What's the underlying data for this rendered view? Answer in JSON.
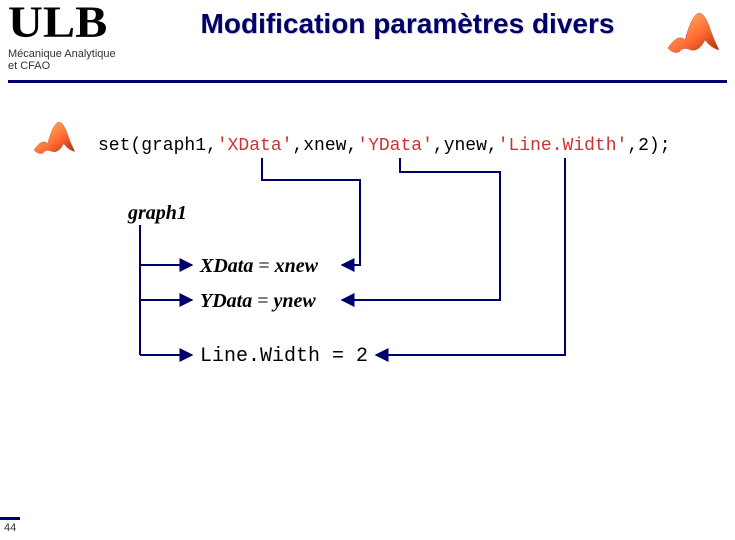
{
  "logo": {
    "text": "ULB",
    "subtitle_line1": "Mécanique Analytique",
    "subtitle_line2": "et CFAO"
  },
  "title": "Modification paramètres divers",
  "code": {
    "prefix": "set(graph1,",
    "s1": "'XData'",
    "m1": ",xnew,",
    "s2": "'YData'",
    "m2": ",ynew,",
    "s3": "'Line.Width'",
    "suffix": ",2);"
  },
  "graph_label": "graph1",
  "rows": [
    {
      "label": "XData",
      "eq": " = ",
      "value": "xnew"
    },
    {
      "label": "YData",
      "eq": " = ",
      "value": "ynew"
    },
    {
      "label": "Line.Width",
      "eq": " = ",
      "value": "2"
    }
  ],
  "page_number": "44"
}
